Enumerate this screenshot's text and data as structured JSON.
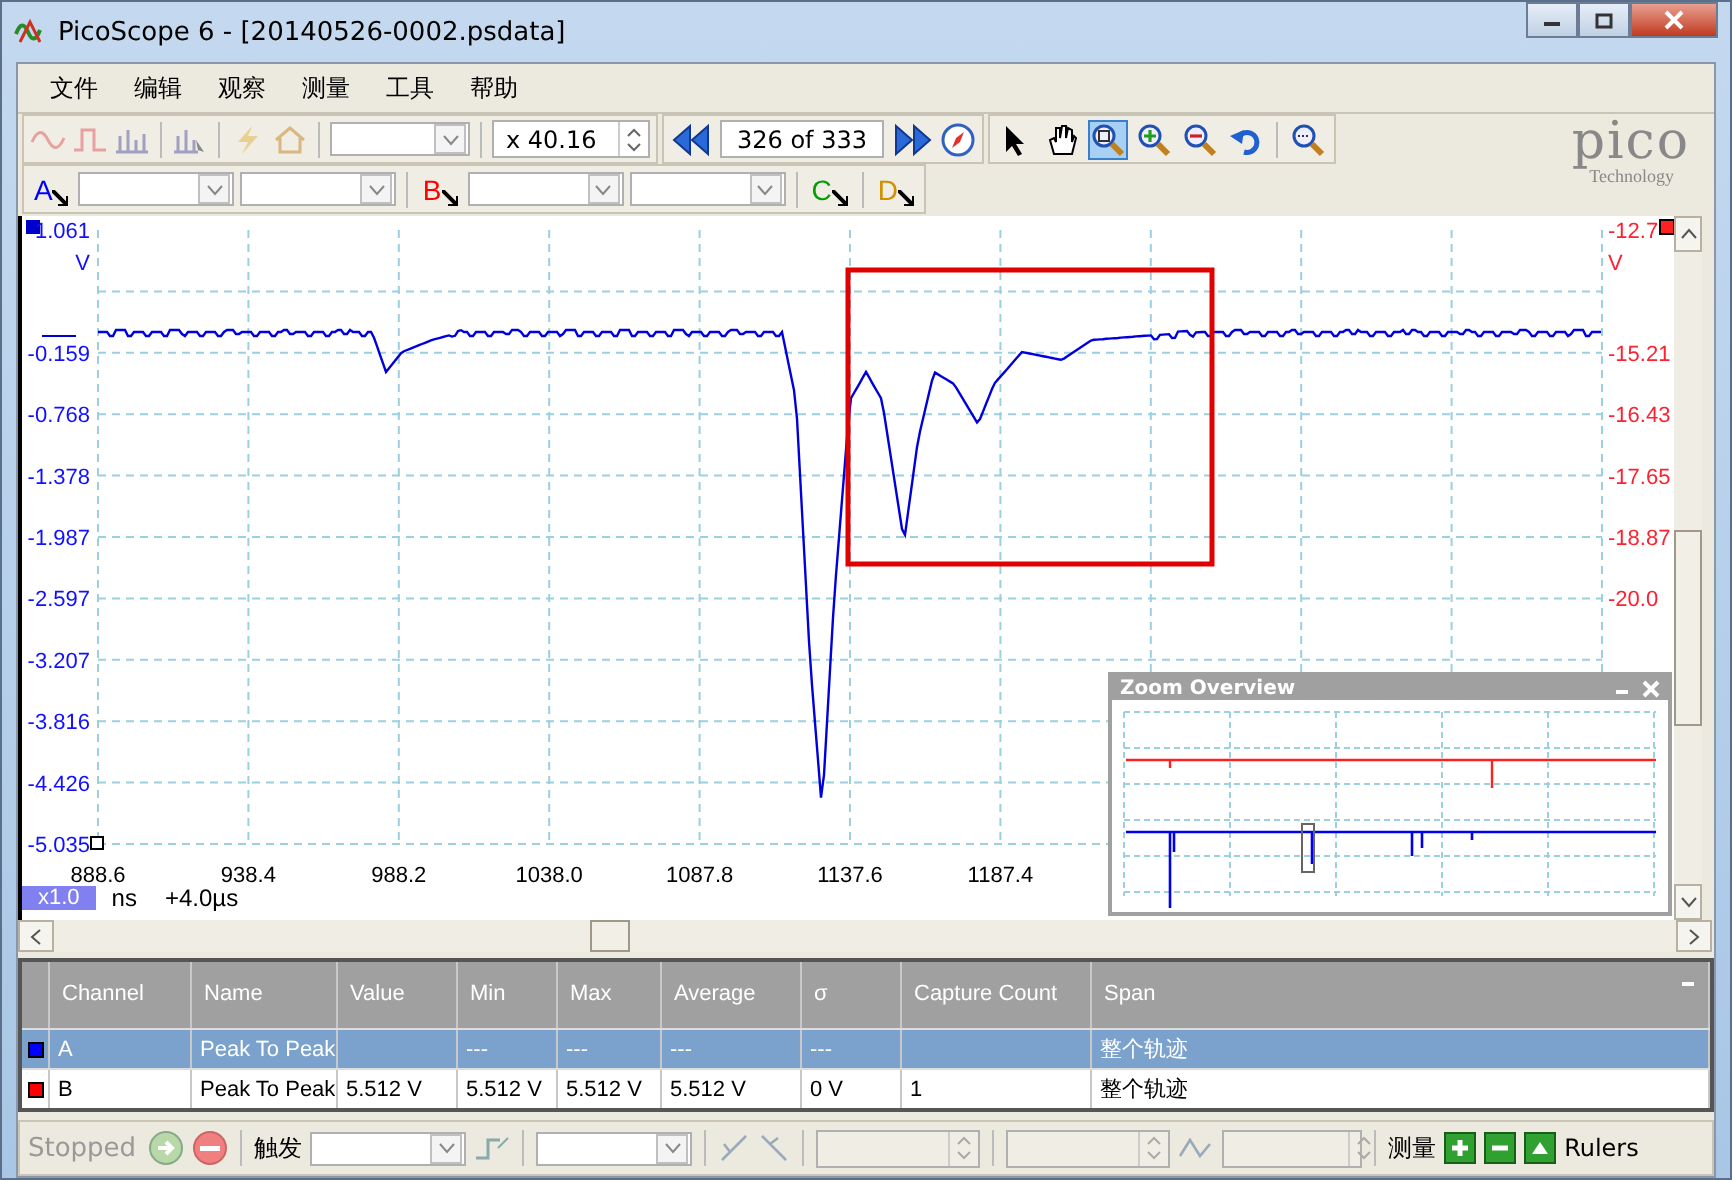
{
  "window": {
    "title": "PicoScope 6 - [20140526-0002.psdata]"
  },
  "menu": [
    "文件",
    "编辑",
    "观察",
    "测量",
    "工具",
    "帮助"
  ],
  "toolbar": {
    "zoom_factor": "x 40.16",
    "buffer": "326 of 333",
    "tools": [
      {
        "kind": "pointer",
        "selected": false
      },
      {
        "kind": "hand",
        "selected": false
      },
      {
        "kind": "zoom-area",
        "selected": true
      },
      {
        "kind": "zoom-in",
        "selected": false
      },
      {
        "kind": "zoom-out",
        "selected": false
      },
      {
        "kind": "undo",
        "selected": false
      },
      {
        "kind": "zoom-full",
        "selected": false
      }
    ]
  },
  "logo": {
    "name": "pico",
    "tagline": "Technology"
  },
  "channels": [
    {
      "label": "A",
      "color": "#0000ff"
    },
    {
      "label": "B",
      "color": "#ff0000"
    },
    {
      "label": "C",
      "color": "#00a000"
    },
    {
      "label": "D",
      "color": "#d09000"
    }
  ],
  "scope": {
    "left_axis": {
      "unit": "V",
      "labels": [
        "1.061",
        "-0.159",
        "-0.768",
        "-1.378",
        "-1.987",
        "-2.597",
        "-3.207",
        "-3.816",
        "-4.426",
        "-5.035"
      ]
    },
    "right_axis": {
      "unit": "V",
      "labels": [
        "-12.7",
        "-15.21",
        "-16.43",
        "-17.65",
        "-18.87",
        "-20.0"
      ]
    },
    "x_labels": [
      "888.6",
      "938.4",
      "988.2",
      "1038.0",
      "1087.8",
      "1137.6",
      "1187.4"
    ],
    "x_unit": "ns",
    "zoom": "x1.0",
    "offset": "+4.0µs"
  },
  "zoom_overview": {
    "title": "Zoom Overview"
  },
  "measurements": {
    "columns": [
      "Channel",
      "Name",
      "Value",
      "Min",
      "Max",
      "Average",
      "σ",
      "Capture Count",
      "Span"
    ],
    "rows": [
      {
        "selected": true,
        "color": "#0000ff",
        "cells": [
          "A",
          "Peak To Peak",
          "",
          "---",
          "---",
          "---",
          "---",
          "",
          "整个轨迹"
        ]
      },
      {
        "selected": false,
        "color": "#ff0000",
        "cells": [
          "B",
          "Peak To Peak",
          "5.512 V",
          "5.512 V",
          "5.512 V",
          "5.512 V",
          "0 V",
          "1",
          "整个轨迹"
        ]
      }
    ]
  },
  "status_bar": {
    "state": "Stopped",
    "trigger_label": "触发",
    "measure_label": "测量",
    "rulers": "Rulers"
  }
}
